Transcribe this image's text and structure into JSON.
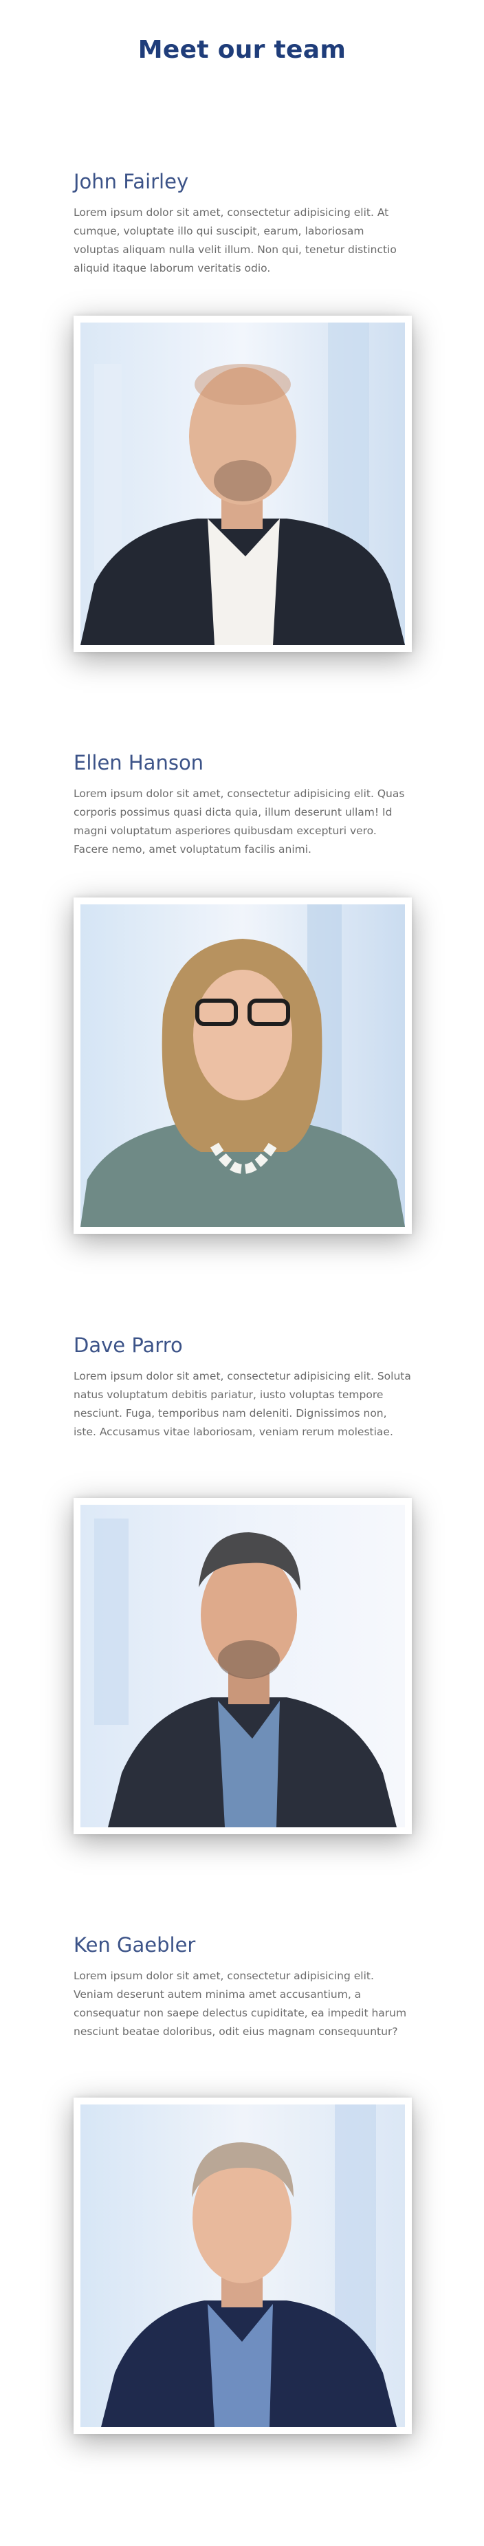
{
  "page": {
    "title": "Meet our team"
  },
  "team": [
    {
      "name": "John Fairley",
      "bio": "Lorem ipsum dolor sit amet, consectetur adipisicing elit. At cumque, voluptate illo qui suscipit, earum, laboriosam voluptas aliquam nulla velit illum. Non qui, tenetur distinctio aliquid itaque laborum veritatis odio.",
      "photo_icon": "portrait-john-fairley"
    },
    {
      "name": "Ellen Hanson",
      "bio": "Lorem ipsum dolor sit amet, consectetur adipisicing elit. Quas corporis possimus quasi dicta quia, illum deserunt ullam! Id magni voluptatum asperiores quibusdam excepturi vero. Facere nemo, amet voluptatum facilis animi.",
      "photo_icon": "portrait-ellen-hanson"
    },
    {
      "name": "Dave Parro",
      "bio": "Lorem ipsum dolor sit amet, consectetur adipisicing elit. Soluta natus voluptatum debitis pariatur, iusto voluptas tempore nesciunt. Fuga, temporibus nam deleniti. Dignissimos non, iste. Accusamus vitae laboriosam, veniam rerum molestiae.",
      "photo_icon": "portrait-dave-parro"
    },
    {
      "name": "Ken Gaebler",
      "bio": "Lorem ipsum dolor sit amet, consectetur adipisicing elit. Veniam deserunt autem minima amet accusantium, a consequatur non saepe delectus cupiditate, ea impedit harum nesciunt beatae doloribus, odit eius magnam consequuntur?",
      "photo_icon": "portrait-ken-gaebler"
    }
  ],
  "colors": {
    "title": "#1f3d7a",
    "name": "#3c5388",
    "body_text": "#6b6b6b",
    "background": "#ffffff"
  }
}
